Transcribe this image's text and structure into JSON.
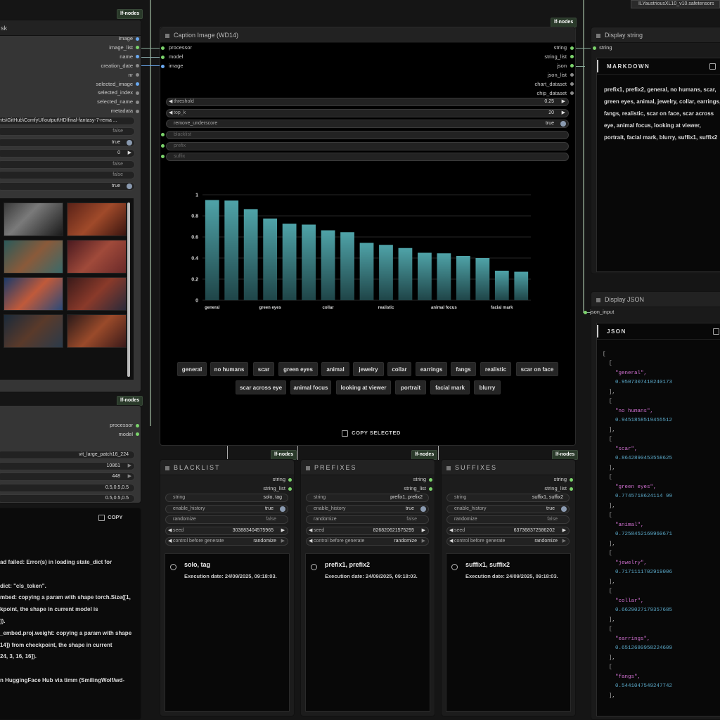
{
  "top_right_label": "ILYaustriousXL10_v10.safetensors",
  "badge": "lf-nodes",
  "left_node": {
    "title": "sk",
    "outputs": [
      "image",
      "image_list",
      "name",
      "creation_date",
      "nr",
      "selected_image",
      "selected_index",
      "selected_name",
      "metadata"
    ],
    "path_value": "nts\\GitHub\\ComfyUI\\output\\HD\\final-fantasy-7-rema ...",
    "widgets": [
      {
        "value": "false"
      },
      {
        "value": "true"
      },
      {
        "value": "0"
      },
      {
        "value": "false"
      },
      {
        "value": "false"
      },
      {
        "value": "true"
      }
    ]
  },
  "left_node2": {
    "outputs": [
      "processor",
      "model"
    ],
    "widgets": [
      {
        "value": "vit_large_patch16_224"
      },
      {
        "value": "10861"
      },
      {
        "value": "448"
      },
      {
        "value": "0.5,0.5,0.5"
      },
      {
        "value": "0.5,0.5,0.5"
      }
    ],
    "copy_label": "COPY",
    "log_lines": [
      "ad failed: Error(s) in loading state_dict for",
      "",
      "dict: \"cls_token\".",
      "mbed: copying a param with shape torch.Size([1,",
      "kpoint, the shape in current model is",
      "]).",
      "_embed.proj.weight: copying a param with shape",
      " 14]) from checkpoint, the shape in current",
      "24, 3, 16, 16]).",
      "",
      "n HuggingFace Hub via timm (SmilingWolf/wd-"
    ]
  },
  "caption_node": {
    "title": "Caption Image (WD14)",
    "inputs": [
      "processor",
      "model",
      "image"
    ],
    "outputs": [
      "string",
      "string_list",
      "json",
      "json_list",
      "chart_dataset",
      "chip_dataset"
    ],
    "widgets": [
      {
        "label": "threshold",
        "value": "0.25"
      },
      {
        "label": "top_k",
        "value": "20"
      },
      {
        "label": "remove_underscore",
        "value": "true"
      }
    ],
    "extra_inputs": [
      "blacklist",
      "prefix",
      "suffix"
    ],
    "tags": [
      "general",
      "no humans",
      "scar",
      "green eyes",
      "animal",
      "jewelry",
      "collar",
      "earrings",
      "fangs",
      "realistic",
      "scar on face",
      "scar across eye",
      "animal focus",
      "looking at viewer",
      "portrait",
      "facial mark",
      "blurry"
    ],
    "copy_selected": "COPY SELECTED"
  },
  "chart_data": {
    "type": "bar",
    "categories": [
      "general",
      "no humans",
      "scar",
      "green eyes",
      "animal",
      "jewelry",
      "collar",
      "earrings",
      "fangs",
      "realistic",
      "scar on face",
      "scar across eye",
      "animal focus",
      "looking at viewer",
      "portrait",
      "facial mark",
      "blurry"
    ],
    "x_tick_labels": [
      "general",
      "",
      "",
      "green eyes",
      "",
      "",
      "collar",
      "",
      "",
      "realistic",
      "",
      "",
      "animal focus",
      "",
      "",
      "facial mark",
      ""
    ],
    "values": [
      0.95,
      0.945,
      0.864,
      0.775,
      0.726,
      0.717,
      0.663,
      0.645,
      0.544,
      0.525,
      0.495,
      0.45,
      0.445,
      0.42,
      0.4,
      0.28,
      0.27
    ],
    "ylim": [
      0,
      1
    ],
    "yticks": [
      "0",
      "0.2",
      "0.4",
      "0.6",
      "0.8",
      "1"
    ],
    "bar_color_top": "#4fa3a8",
    "bar_color_bottom": "#1f4548",
    "grid": true
  },
  "display_string": {
    "title": "Display string",
    "input": "string",
    "panel_label": "MARKDOWN",
    "text": "prefix1, prefix2, general, no humans, scar, green eyes, animal, jewelry, collar, earrings, fangs, realistic, scar on face, scar across eye, animal focus, looking at viewer, portrait, facial mark, blurry, suffix1, suffix2"
  },
  "display_json": {
    "title": "Display JSON",
    "input": "json_input",
    "panel_label": "JSON",
    "entries": [
      {
        "tag": "\"general\",",
        "score": "0.9507307410240173"
      },
      {
        "tag": "\"no humans\",",
        "score": "0.9451858519455512"
      },
      {
        "tag": "\"scar\",",
        "score": "0.8642890453558625"
      },
      {
        "tag": "\"green eyes\",",
        "score": "0.7745718624114 99"
      },
      {
        "tag": "\"animal\",",
        "score": "0.7258452169960671"
      },
      {
        "tag": "\"jewelry\",",
        "score": "0.7171111702919006"
      },
      {
        "tag": "\"collar\",",
        "score": "0.6629027179357685"
      },
      {
        "tag": "\"earrings\",",
        "score": "0.6512680958224609"
      },
      {
        "tag": "\"fangs\",",
        "score": "0.5441047549247742"
      }
    ]
  },
  "blacklist": {
    "title": "BLACKLIST",
    "string_value": "solo, tag",
    "enable_history": "true",
    "randomize": "false",
    "seed": "303883404575965",
    "control": "randomize",
    "result": "solo, tag",
    "exec": "Execution date: 24/09/2025, 09:18:03."
  },
  "prefixes": {
    "title": "PREFIXES",
    "string_value": "prefix1, prefix2",
    "enable_history": "true",
    "randomize": "false",
    "seed": "826820621575295",
    "control": "randomize",
    "result": "prefix1, prefix2",
    "exec": "Execution date: 24/09/2025, 09:18:03."
  },
  "suffixes": {
    "title": "SUFFIXES",
    "string_value": "suffix1, suffix2",
    "enable_history": "true",
    "randomize": "false",
    "seed": "637368372586202",
    "control": "randomize",
    "result": "suffix1, suffix2",
    "exec": "Execution date: 24/09/2025, 09:18:03."
  },
  "labels": {
    "string": "string",
    "string_list": "string_list",
    "enable_history": "enable_history",
    "randomize": "randomize",
    "seed": "seed",
    "control": "control before generate"
  }
}
